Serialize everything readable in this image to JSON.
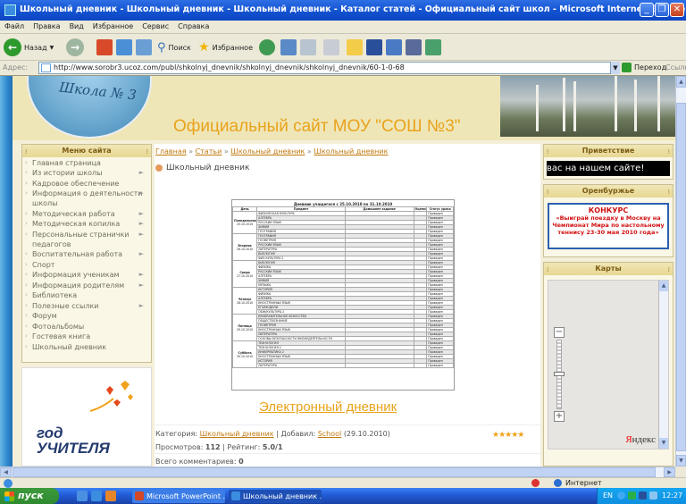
{
  "window": {
    "title": "Школьный дневник - Школьный дневник - Школьный дневник - Каталог статей - Официальный сайт школ - Microsoft Internet Explorer"
  },
  "menubar": [
    "Файл",
    "Правка",
    "Вид",
    "Избранное",
    "Сервис",
    "Справка"
  ],
  "toolbar": {
    "back": "Назад",
    "search": "Поиск",
    "favorites": "Избранное"
  },
  "address": {
    "label": "Адрес:",
    "url": "http://www.sorobr3.ucoz.com/publ/shkolnyj_dnevnik/shkolnyj_dnevnik/shkolnyj_dnevnik/60-1-0-68",
    "go": "Переход",
    "links": "Ссылки"
  },
  "site": {
    "logo_text": "Школа № 3",
    "title": "Официальный сайт МОУ \"СОШ №3\""
  },
  "left_menu": {
    "title": "Меню сайта",
    "items": [
      {
        "label": "Главная страница",
        "sub": false
      },
      {
        "label": "Из истории школы",
        "sub": true
      },
      {
        "label": "Кадровое обеспечение",
        "sub": false
      },
      {
        "label": "Информация о деятельности школы",
        "sub": true
      },
      {
        "label": "Методическая работа",
        "sub": true
      },
      {
        "label": "Методическая копилка",
        "sub": true
      },
      {
        "label": "Персональные странички педагогов",
        "sub": true
      },
      {
        "label": "Воспитательная работа",
        "sub": true
      },
      {
        "label": "Спорт",
        "sub": false
      },
      {
        "label": "Информация ученикам",
        "sub": true
      },
      {
        "label": "Информация родителям",
        "sub": true
      },
      {
        "label": "Библиотека",
        "sub": false
      },
      {
        "label": "Полезные ссылки",
        "sub": true
      },
      {
        "label": "Форум",
        "sub": false
      },
      {
        "label": "Фотоальбомы",
        "sub": false
      },
      {
        "label": "Гостевая книга",
        "sub": false
      },
      {
        "label": "Школьный дневник",
        "sub": false
      }
    ]
  },
  "promo": {
    "line1": "год",
    "line2": "УЧИТЕЛЯ"
  },
  "breadcrumb": {
    "home": "Главная",
    "sep": "»",
    "articles": "Статьи",
    "cat1": "Школьный дневник",
    "cat2": "Школьный дневник"
  },
  "page_heading": "Школьный дневник",
  "diary": {
    "title": "Дневник учащегося с 25.10.2010 по 31.10.2010",
    "headers": [
      "День",
      "Предмет",
      "Домашнее задание",
      "Оценка",
      "Статус урока"
    ],
    "days": [
      {
        "name": "Понедельник",
        "date": "25.10.2010",
        "rows": [
          "ФИЗИЧЕСКАЯ КУЛЬТУРА",
          "АЛГЕБРА",
          "РУССКИЙ ЯЗЫК",
          "ХИМИЯ",
          "ГЕОГРАФИЯ"
        ]
      },
      {
        "name": "Вторник",
        "date": "26.10.2010",
        "rows": [
          "ГЕОГРАФИЯ",
          "ГЕОМЕТРИЯ",
          "РУССКИЙ ЯЗЫК",
          "ЛИТЕРАТУРА",
          "БИОЛОГИЯ",
          "ФИЗ-КУЛЬТУРА 2"
        ]
      },
      {
        "name": "Среда",
        "date": "27.10.2010",
        "rows": [
          "БИОЛОГИЯ",
          "ФИЗИКА",
          "РУССКИЙ ЯЗЫК",
          "АЛГЕБРА",
          "ХИМИЯ",
          "МУЗЫКА"
        ]
      },
      {
        "name": "Четверг",
        "date": "28.10.2010",
        "rows": [
          "ИСТОРИЯ",
          "ФИЗИКА",
          "АЛГЕБРА",
          "ИНОСТРАННЫЙ ЯЗЫК",
          "ЕГЭ/МОДЕЛИ",
          "ОБЖ/КУЛЬТУРА 2"
        ]
      },
      {
        "name": "Пятница",
        "date": "29.10.2010",
        "rows": [
          "ИЗОБРАЗИТЕЛЬНОЕ ИСКУССТВО",
          "ОБЩЕСТВОЗНАНИЕ",
          "ГЕОМЕТРИЯ",
          "ИНОСТРАННЫЙ ЯЗЫК",
          "ЛИТЕРАТУРА",
          "ОСНОВЫ БЕЗОПАСНОСТИ ЖИЗНЕДЕЯТЕЛЬНОСТИ"
        ]
      },
      {
        "name": "Суббота",
        "date": "30.10.2010",
        "rows": [
          "ТЕХНОЛОГИЯ",
          "ТЕХНОЛОГИЯ 2",
          "ИНФОРМАТИКА 2",
          "ИНОСТРАННЫЙ ЯЗЫК",
          "ИСТОРИЯ",
          "ЛИТЕРАТУРА"
        ]
      }
    ],
    "status": "Проведен"
  },
  "article": {
    "title": "Электронный дневник",
    "category_label": "Категория:",
    "category": "Школьный дневник",
    "added_label": "| Добавил:",
    "author": "School",
    "date": "(29.10.2010)",
    "views_label": "Просмотров:",
    "views": "112",
    "rating_label": "| Рейтинг:",
    "rating": "5.0/1",
    "comments_label": "Всего комментариев:",
    "comments": "0"
  },
  "right": {
    "greet_title": "Приветствие",
    "ticker": "вас на нашем сайте!",
    "orenburg_title": "Оренбуржье",
    "contest_head": "КОНКУРС",
    "contest_text": "«Выиграй поездку в Москву на Чемпионат Мира по настольному теннису 23-30 мая 2010 года»",
    "maps_title": "Карты",
    "yandex_red": "Я",
    "yandex_rest": "ндекс"
  },
  "status": {
    "zone": "Интернет"
  },
  "taskbar": {
    "start": "пуск",
    "tasks": [
      "Microsoft PowerPoint ...",
      "Школьный дневник ..."
    ],
    "lang": "EN",
    "time": "12:27"
  }
}
